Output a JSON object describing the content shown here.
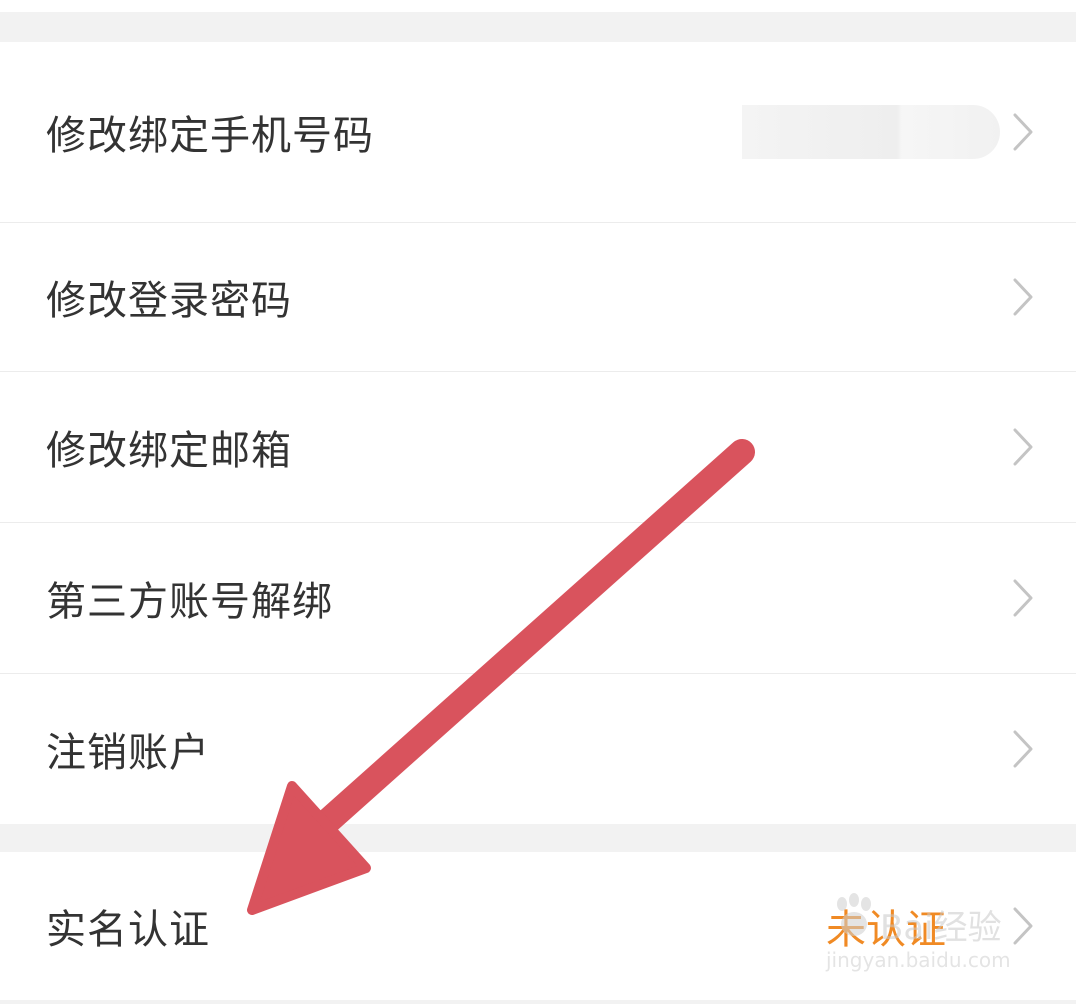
{
  "settings": {
    "rows": [
      {
        "label": "修改绑定手机号码"
      },
      {
        "label": "修改登录密码"
      },
      {
        "label": "修改绑定邮箱"
      },
      {
        "label": "第三方账号解绑"
      },
      {
        "label": "注销账户"
      }
    ],
    "verification": {
      "label": "实名认证",
      "status": "未认证"
    }
  },
  "annotation": {
    "arrow_color": "#d9535d"
  },
  "watermark": {
    "brand": "Bai经验",
    "domain": "jingyan.baidu.com"
  },
  "colors": {
    "background": "#f2f2f2",
    "row_background": "#ffffff",
    "label_text": "#333333",
    "status_orange": "#f08a24",
    "chevron": "#c4c4c4"
  }
}
